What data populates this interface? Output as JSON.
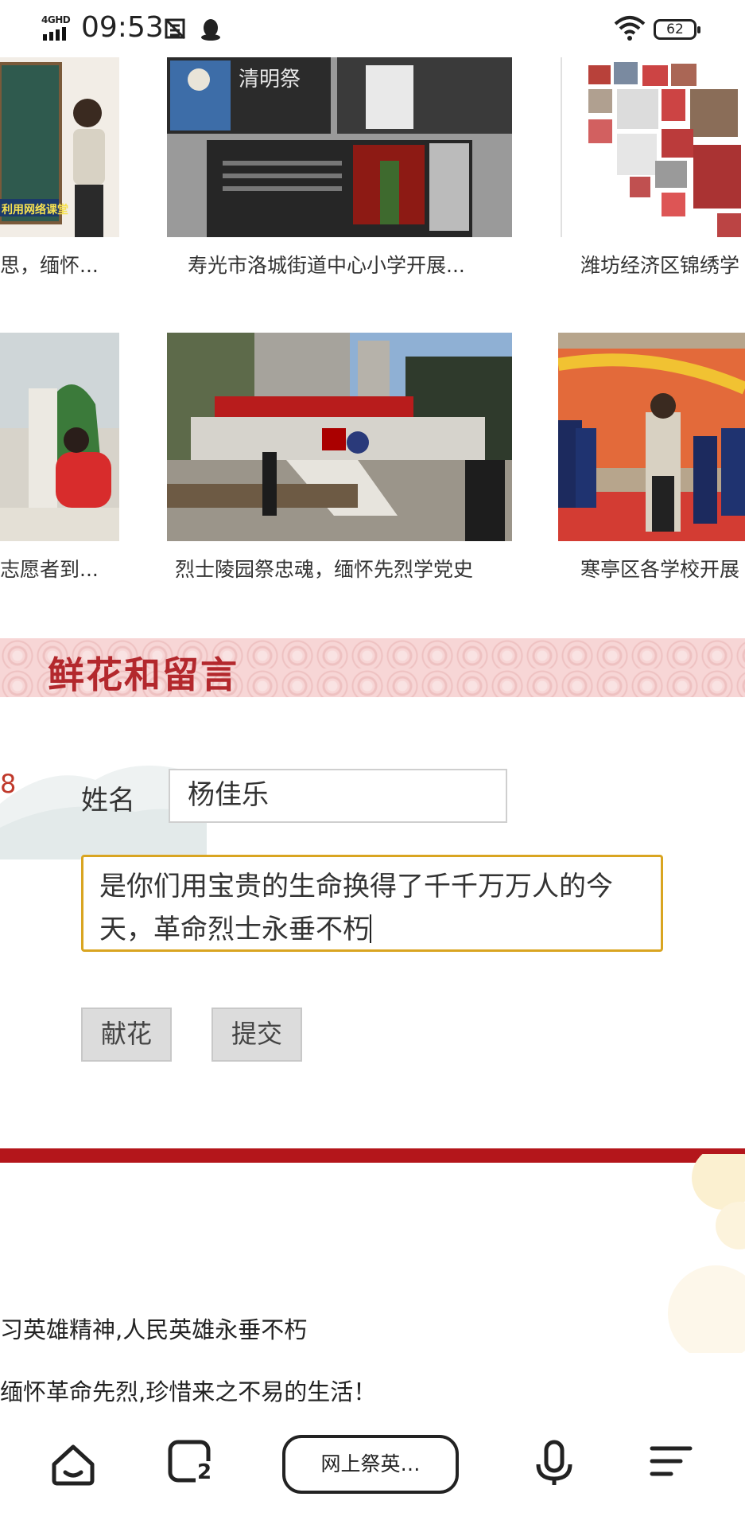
{
  "status_bar": {
    "network": "4GHD",
    "time": "09:53",
    "battery": "62"
  },
  "news": {
    "row1": [
      {
        "caption": "思，缅怀...",
        "thumb": "classroom-teacher"
      },
      {
        "caption": "寿光市洛城街道中心小学开展...",
        "thumb": "qingming-online-class"
      },
      {
        "caption": "潍坊经济区锦绣学",
        "thumb": "student-photo-collage"
      }
    ],
    "row2": [
      {
        "caption": "志愿者到...",
        "thumb": "volunteer-memorial"
      },
      {
        "caption": "烈士陵园祭忠魂，缅怀先烈学党史",
        "thumb": "martyrs-cemetery-monument"
      },
      {
        "caption": "寒亭区各学校开展",
        "thumb": "school-memorial-event"
      }
    ],
    "banner_text_left": "利用网络课堂"
  },
  "section": {
    "title": "鲜花和留言"
  },
  "form": {
    "edge_number": "8",
    "name_label": "姓名",
    "name_value": "杨佳乐",
    "message_value": "是你们用宝贵的生命换得了千千万万人的今天，革命烈士永垂不朽",
    "flower_button": "献花",
    "submit_button": "提交"
  },
  "messages": [
    "习英雄精神,人民英雄永垂不朽",
    "缅怀革命先烈,珍惜来之不易的生活！"
  ],
  "bottom_nav": {
    "tab_title": "网上祭英…",
    "tab_count": "2",
    "icons": [
      "home-icon",
      "tabs-icon",
      "microphone-icon",
      "menu-icon"
    ]
  },
  "colors": {
    "accent_red": "#b4161b",
    "title_red": "#b3282d",
    "focus_border": "#d9a521"
  }
}
